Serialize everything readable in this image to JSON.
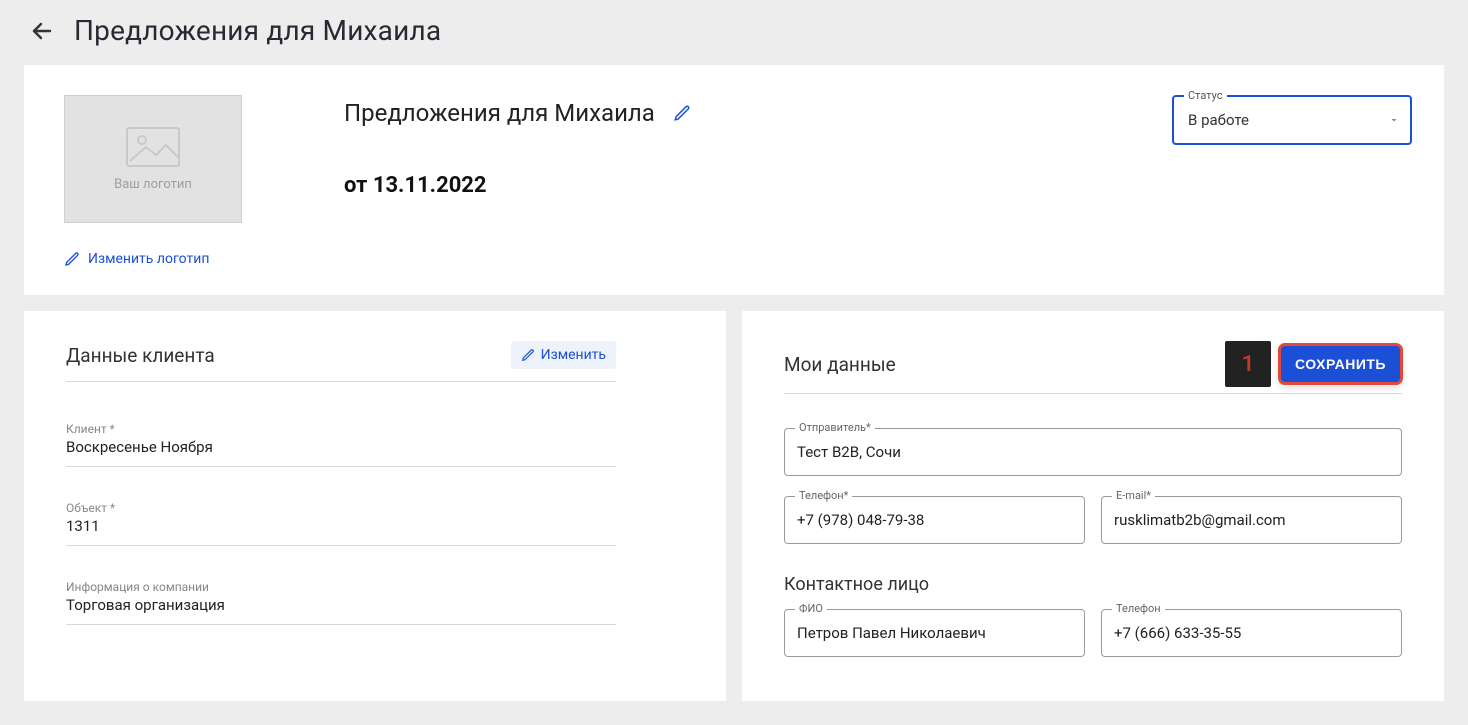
{
  "page_title": "Предложения для Михаила",
  "top": {
    "logo_placeholder": "Ваш логотип",
    "change_logo": "Изменить логотип",
    "proposal_title": "Предложения для Михаила",
    "date": "от 13.11.2022",
    "status_label": "Статус",
    "status_value": "В работе"
  },
  "client": {
    "section_title": "Данные клиента",
    "edit_label": "Изменить",
    "client_label": "Клиент *",
    "client_value": "Воскресенье Ноября",
    "object_label": "Объект *",
    "object_value": "1311",
    "company_label": "Информация о компании",
    "company_value": "Торговая организация"
  },
  "my": {
    "section_title": "Мои данные",
    "step": "1",
    "save_label": "СОХРАНИТЬ",
    "sender_label": "Отправитель*",
    "sender_value": "Тест В2В, Сочи",
    "phone_label": "Телефон*",
    "phone_value": "+7 (978) 048-79-38",
    "email_label": "E-mail*",
    "email_value": "rusklimatb2b@gmail.com",
    "contact_title": "Контактное лицо",
    "contact_name_label": "ФИО",
    "contact_name_value": "Петров Павел Николаевич",
    "contact_phone_label": "Телефон",
    "contact_phone_value": "+7 (666) 633-35-55"
  }
}
